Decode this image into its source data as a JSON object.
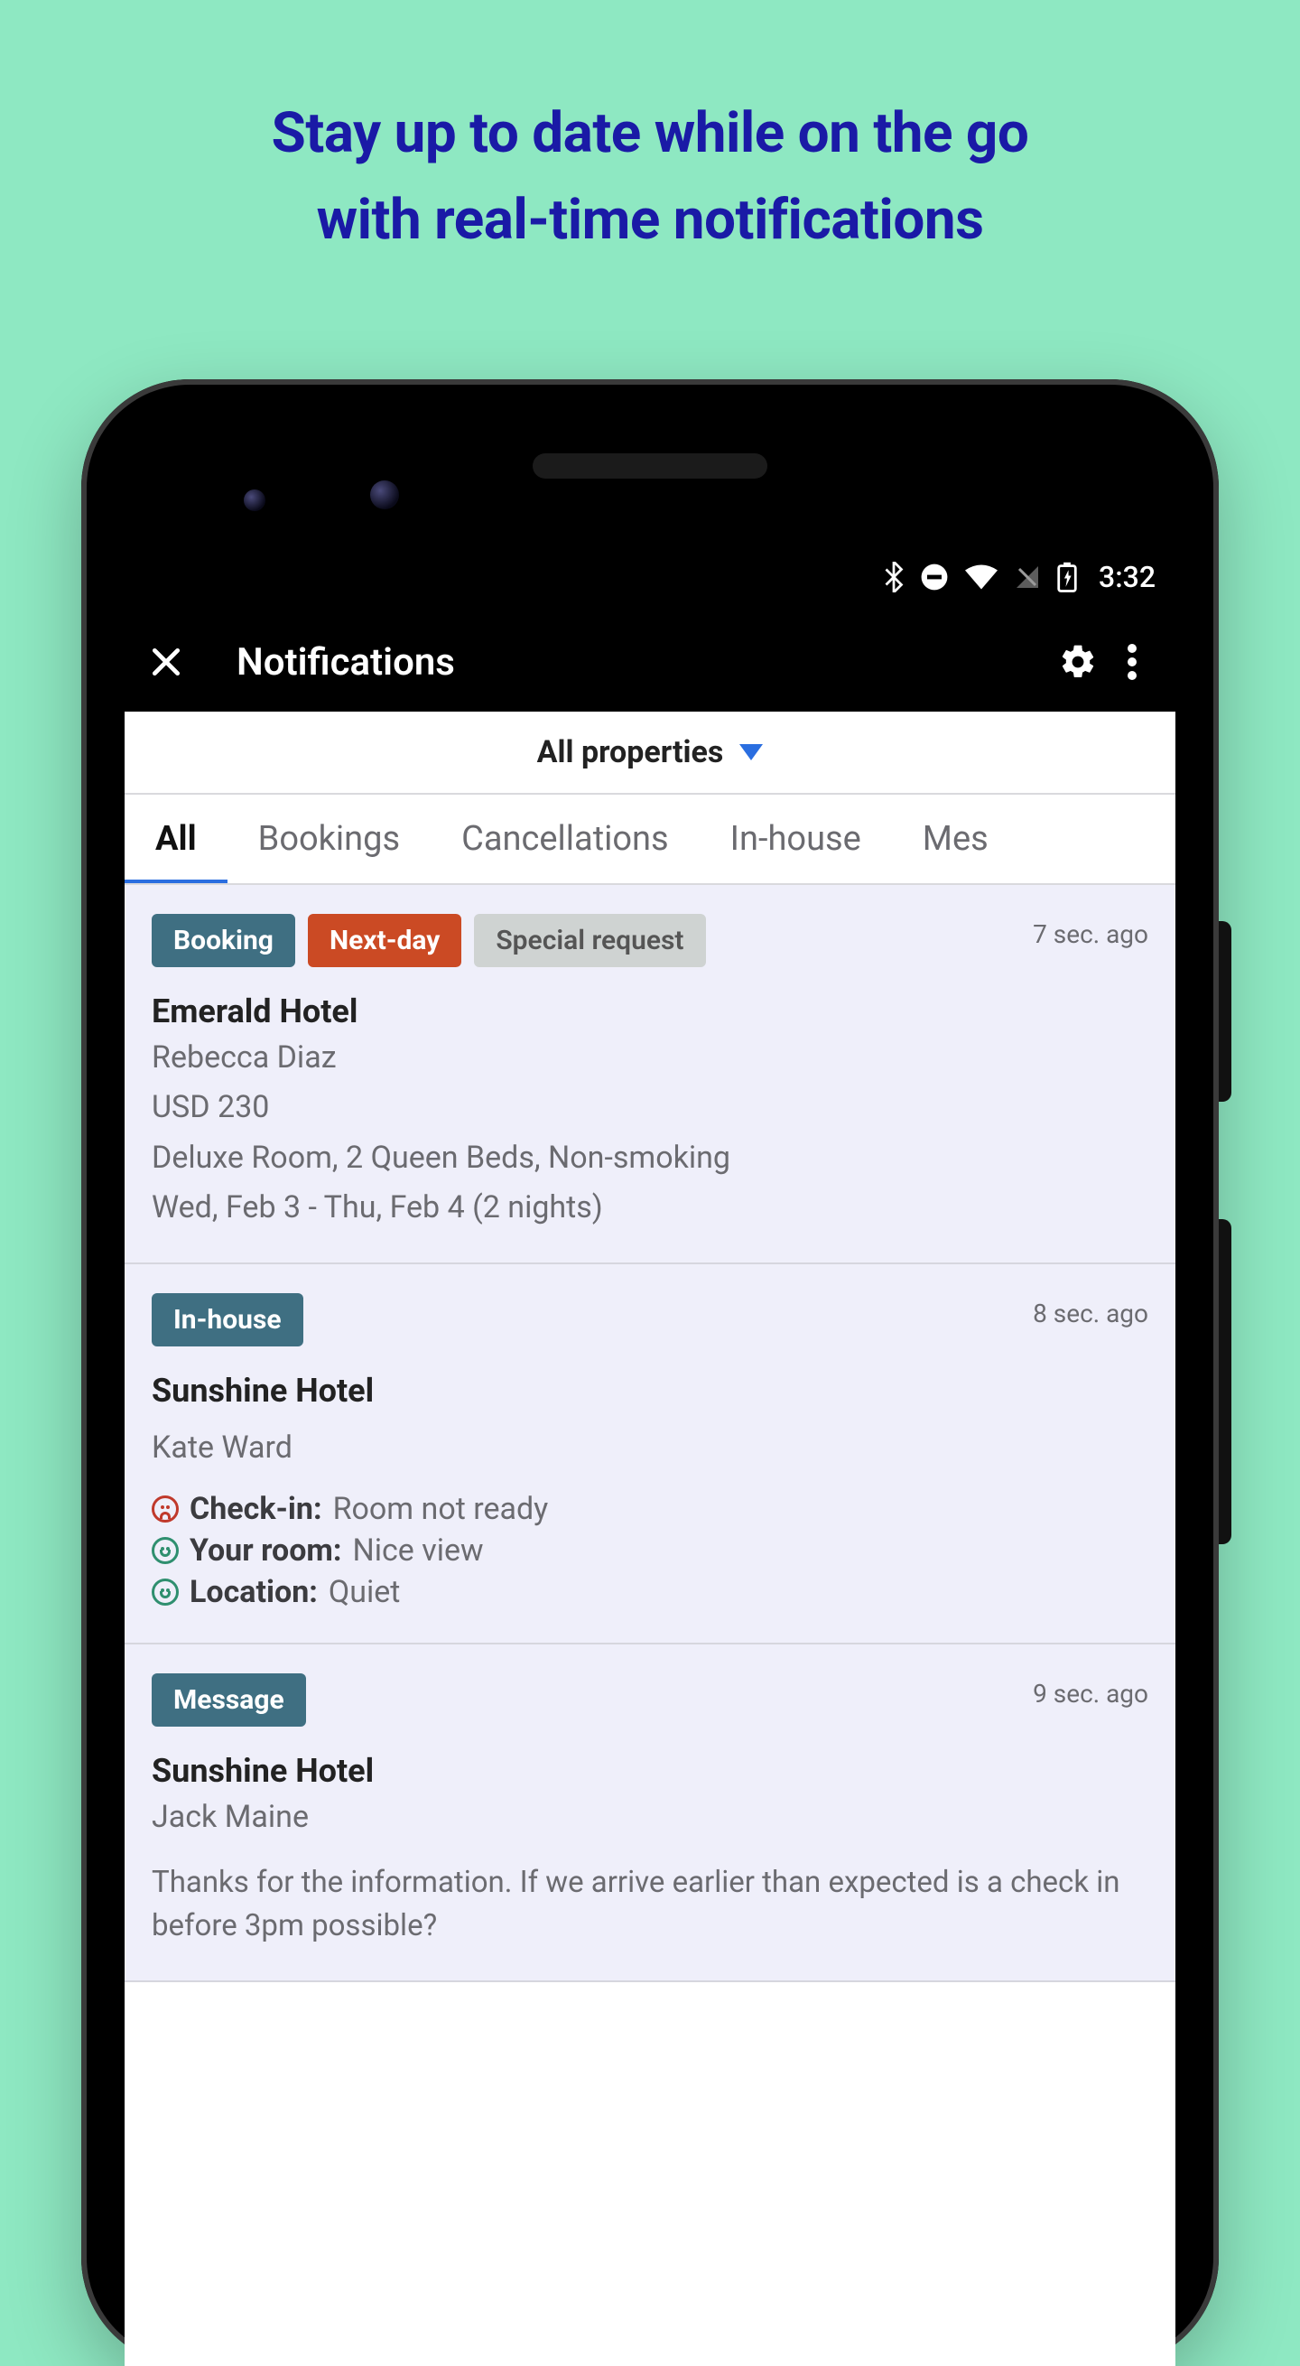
{
  "promo": {
    "line1": "Stay up to date while on the go",
    "line2": "with real-time notifications"
  },
  "status": {
    "time": "3:32",
    "icons": [
      "bluetooth",
      "dnd",
      "wifi",
      "cell",
      "battery-charging"
    ]
  },
  "appbar": {
    "title": "Notifications"
  },
  "property_selector": {
    "label": "All properties"
  },
  "tabs": [
    {
      "label": "All",
      "active": true
    },
    {
      "label": "Bookings",
      "active": false
    },
    {
      "label": "Cancellations",
      "active": false
    },
    {
      "label": "In-house",
      "active": false
    },
    {
      "label": "Mes",
      "active": false
    }
  ],
  "tag_labels": {
    "booking": "Booking",
    "next_day": "Next-day",
    "special_request": "Special request",
    "in_house": "In-house",
    "message": "Message"
  },
  "feedback_labels": {
    "checkin": "Check-in:",
    "your_room": "Your room:",
    "location": "Location:"
  },
  "notifications": [
    {
      "tags": [
        "booking",
        "next_day",
        "special_request"
      ],
      "timestamp": "7 sec. ago",
      "hotel": "Emerald Hotel",
      "guest": "Rebecca Diaz",
      "price": "USD 230",
      "room": "Deluxe Room, 2 Queen Beds, Non-smoking",
      "dates": "Wed, Feb 3 - Thu, Feb 4 (2 nights)"
    },
    {
      "tags": [
        "in_house"
      ],
      "timestamp": "8 sec. ago",
      "hotel": "Sunshine Hotel",
      "guest": "Kate Ward",
      "feedback": [
        {
          "mood": "sad",
          "label_key": "checkin",
          "value": "Room not ready"
        },
        {
          "mood": "happy",
          "label_key": "your_room",
          "value": "Nice view"
        },
        {
          "mood": "happy",
          "label_key": "location",
          "value": "Quiet"
        }
      ]
    },
    {
      "tags": [
        "message"
      ],
      "timestamp": "9 sec. ago",
      "hotel": "Sunshine Hotel",
      "guest": "Jack Maine",
      "message": "Thanks for the information. If we arrive earlier than expected is a check in before 3pm possible?"
    }
  ]
}
